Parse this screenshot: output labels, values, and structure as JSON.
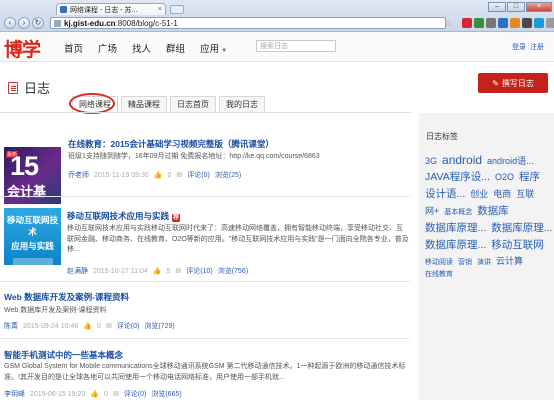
{
  "browser": {
    "tab_title": "网络课程 - 日志 - 苏...",
    "address_prefix": "",
    "address_host": "kj.gist-edu.cn",
    "address_rest": ":8008/blog/c-51-1"
  },
  "site": {
    "logo": "博学",
    "nav": [
      "首页",
      "广场",
      "找人",
      "群组",
      "应用"
    ],
    "search_placeholder": "搜索日志",
    "login": "登录",
    "register": "注册"
  },
  "page": {
    "title": "日志",
    "write_button": "撰写日志",
    "tabs": [
      "网络课程",
      "精品课程",
      "日志首页",
      "我的日志"
    ]
  },
  "posts": [
    {
      "title": "在线教育：2015会计基础学习视频完整版（腾讯课堂）",
      "desc": "班级1支持随到随学，16年09月过期 免费报名地址：http://ke.qq.com/course/6863",
      "author": "乔老师",
      "date": "2015-11-19 09:30",
      "likes": "0",
      "comments": "评论(0)",
      "views": "浏览(25)",
      "thumb_big": "15",
      "thumb_sub": "会计基",
      "thumb_tag": "最新"
    },
    {
      "title": "移动互联网技术应用与实践",
      "desc": "移动互联网技术应用与实践移动互联网时代来了：高速移动网络覆盖，拥有智能移动终端，享受移动社交、互联网金融、移动商务、在线教育、O2O等新的应用。\"移动互联网技术应用与实践\"是一门面向全院各专业，普及移...",
      "author": "赵满静",
      "date": "2015-10-27 11:04",
      "likes": "5",
      "comments": "评论(10)",
      "views": "浏览(756)",
      "thumb_line1": "移动互联网技术",
      "thumb_line2": "应用与实践"
    },
    {
      "title": "Web 数据库开发及案例-课程资料",
      "desc": "Web 数据库开发及案例-课程资料",
      "author": "陈菁",
      "date": "2015-09-24 10:46",
      "likes": "0",
      "comments": "评论(0)",
      "views": "浏览(729)"
    },
    {
      "title": "智能手机测试中的一些基本概念",
      "desc": "GSM Global System for Mobile communications全球移动通讯系统GSM 第二代移动通信技术。1一种起源于欧洲的移动通信技术标准。!其开发目的是让全球各地可以共同使用一个移动电话网络标准，用户使用一部手机就...",
      "author": "李玥峰",
      "date": "2015-06-15 19:20",
      "likes": "0",
      "comments": "评论(0)",
      "views": "浏览(665)"
    }
  ],
  "sidebar": {
    "title": "日志标签",
    "tags": [
      {
        "text": "3G",
        "size": "s2"
      },
      {
        "text": "android",
        "size": "s4"
      },
      {
        "text": "android语...",
        "size": "s2"
      },
      {
        "text": "JAVA程序设...",
        "size": "s3"
      },
      {
        "text": "O2O",
        "size": "s2"
      },
      {
        "text": "程序",
        "size": "s3"
      },
      {
        "text": "设计语...",
        "size": "s3"
      },
      {
        "text": "创业",
        "size": "s2"
      },
      {
        "text": "电商",
        "size": "s2"
      },
      {
        "text": "互联",
        "size": "s2"
      },
      {
        "text": "网+",
        "size": "s2"
      },
      {
        "text": "基本概念",
        "size": "s1"
      },
      {
        "text": "数据库",
        "size": "s3"
      },
      {
        "text": "数据库原理...",
        "size": "s3"
      },
      {
        "text": "数据库原理...",
        "size": "s3"
      },
      {
        "text": "数据库原理...",
        "size": "s3"
      },
      {
        "text": "移动互联网",
        "size": "s3"
      },
      {
        "text": "移动阅读",
        "size": "s1"
      },
      {
        "text": "营销",
        "size": "s1"
      },
      {
        "text": "演讲",
        "size": "s1"
      },
      {
        "text": "云计算",
        "size": "s2"
      },
      {
        "text": "在线教育",
        "size": "s1"
      }
    ]
  }
}
